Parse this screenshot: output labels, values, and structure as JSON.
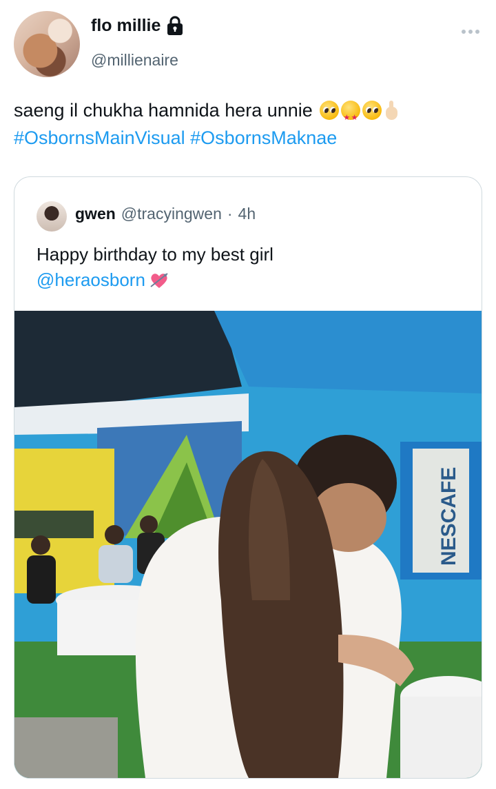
{
  "tweet": {
    "author_name": "flo millie",
    "author_handle": "@millienaire",
    "text": "saeng il chukha hamnida hera unnie",
    "emojis": [
      "pleading-face",
      "star-struck",
      "pleading-face",
      "ok-hand"
    ],
    "hashtags": [
      "#OsbornsMainVisual",
      "#OsbornsMaknae"
    ]
  },
  "quote": {
    "author_name": "gwen",
    "author_handle": "@tracyingwen",
    "separator": "·",
    "time": "4h",
    "text": "Happy birthday to my best girl",
    "mention": "@heraosborn",
    "emoji": "heart-with-arrow"
  },
  "photo": {
    "sign_text": "NESCAFE"
  },
  "colors": {
    "link": "#1d9bf0",
    "secondary_text": "#536471",
    "border": "#cfd9de"
  }
}
